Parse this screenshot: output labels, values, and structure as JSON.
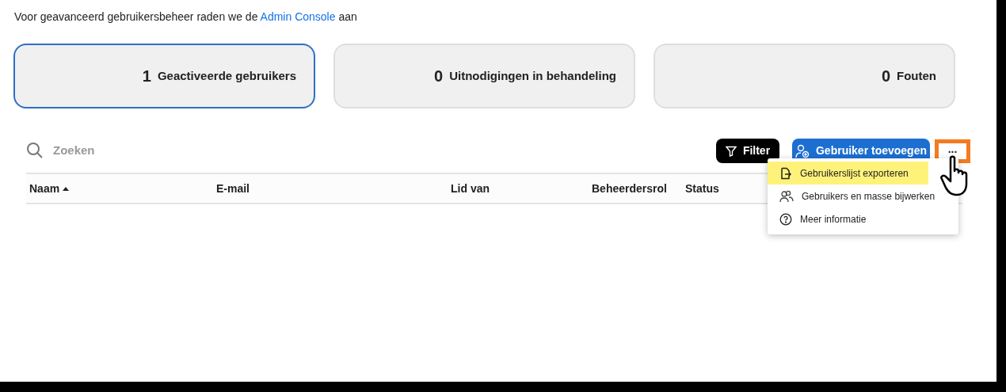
{
  "notice": {
    "text": "Voor geavanceerd gebruikersbeheer raden we de",
    "link": "Admin Console",
    "suffix": "aan"
  },
  "stats": [
    {
      "count": "1",
      "label": "Geactiveerde gebruikers",
      "selected": true
    },
    {
      "count": "0",
      "label": "Uitnodigingen in behandeling",
      "selected": false
    },
    {
      "count": "0",
      "label": "Fouten",
      "selected": false
    }
  ],
  "search": {
    "placeholder": "Zoeken"
  },
  "toolbar": {
    "filter": "Filter",
    "add_user": "Gebruiker toevoegen",
    "more": "...",
    "more_highlighted": true
  },
  "table": {
    "columns": [
      {
        "label": "Naam",
        "sorted": true
      },
      {
        "label": "E-mail",
        "sorted": false
      },
      {
        "label": "Lid van",
        "sorted": false
      },
      {
        "label": "Beheerdersrol",
        "sorted": false
      },
      {
        "label": "Status",
        "sorted": false
      }
    ]
  },
  "menu": {
    "items": [
      {
        "kind": "export",
        "label": "Gebruikerslijst exporteren",
        "selected": true
      },
      {
        "kind": "bulk",
        "label": "Gebruikers en masse bijwerken",
        "selected": false
      },
      {
        "kind": "help",
        "label": "Meer informatie",
        "selected": false
      }
    ]
  }
}
